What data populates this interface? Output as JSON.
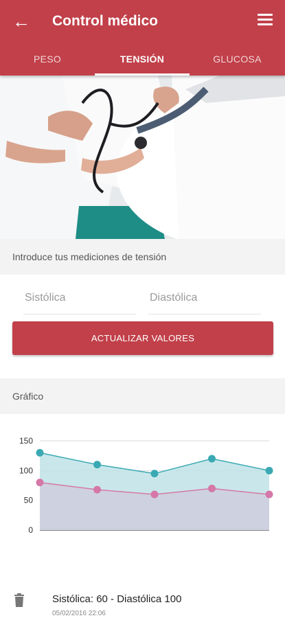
{
  "appbar": {
    "title": "Control médico",
    "back_icon": "arrow-back-icon",
    "menu_icon": "hamburger-menu-icon"
  },
  "tabs": [
    {
      "label": "PESO",
      "active": false
    },
    {
      "label": "TENSIÓN",
      "active": true
    },
    {
      "label": "GLUCOSA",
      "active": false
    }
  ],
  "form": {
    "section_label": "Introduce tus mediciones de tensión",
    "systolic_placeholder": "Sistólica",
    "diastolic_placeholder": "Diastólica",
    "submit_label": "ACTUALIZAR VALORES"
  },
  "chart_section": {
    "label": "Gráfico"
  },
  "chart_data": {
    "type": "area",
    "x": [
      1,
      2,
      3,
      4,
      5
    ],
    "ylim": [
      0,
      150
    ],
    "yticks": [
      0,
      50,
      100,
      150
    ],
    "series": [
      {
        "values": [
          130,
          110,
          95,
          120,
          100
        ],
        "color": "#3aa9b3",
        "fill": "#bfe3e6"
      },
      {
        "values": [
          80,
          68,
          60,
          70,
          60
        ],
        "color": "#d578a8",
        "fill": "#cfcddd"
      }
    ]
  },
  "history": [
    {
      "text": "Sistólica: 60 - Diastólica 100",
      "date": "05/02/2016 22:06",
      "icon": "trash-icon"
    }
  ],
  "colors": {
    "primary": "#c1404a"
  }
}
